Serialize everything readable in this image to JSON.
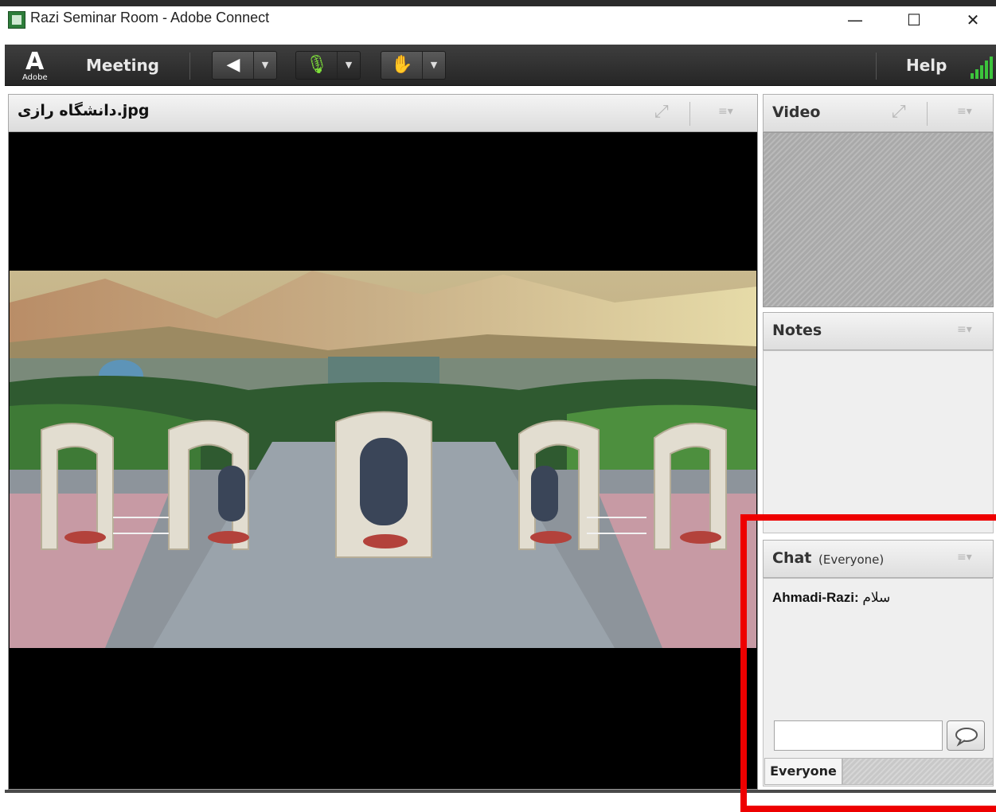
{
  "window": {
    "title": "Razi Seminar Room - Adobe Connect",
    "controls": {
      "minimize": "—",
      "maximize": "☐",
      "close": "✕"
    }
  },
  "menubar": {
    "logo_text": "Adobe",
    "meeting_label": "Meeting",
    "help_label": "Help",
    "tools": [
      {
        "icon": "speaker-icon",
        "glyph": "◀"
      },
      {
        "icon": "microphone-muted-icon",
        "glyph": "🎙"
      },
      {
        "icon": "raise-hand-icon",
        "glyph": "✋"
      }
    ],
    "dropdown_glyph": "▼"
  },
  "content_pod": {
    "title": "دانشگاه رازی.jpg",
    "fullscreen_glyph": "⤢",
    "menu_glyph": "≡▾"
  },
  "video_pod": {
    "title": "Video"
  },
  "notes_pod": {
    "title": "Notes"
  },
  "chat_pod": {
    "title": "Chat",
    "audience": "(Everyone)",
    "messages": [
      {
        "sender": "Ahmadi-Razi:",
        "text": "سلام"
      }
    ],
    "input_value": "",
    "tab_label": "Everyone"
  },
  "colors": {
    "menubar_bg": "#2f2f2f",
    "mic_active": "#7fe03a",
    "signal": "#3cc43c",
    "highlight": "#ee0000"
  }
}
